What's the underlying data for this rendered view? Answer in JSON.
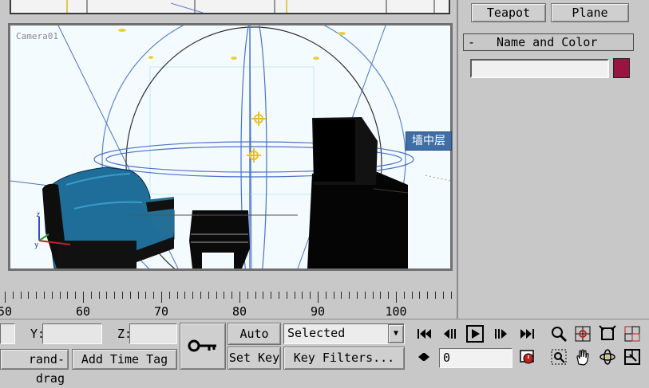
{
  "viewport": {
    "label": "Camera01",
    "object_tag": "墙中层"
  },
  "create_panel": {
    "teapot_label": "Teapot",
    "plane_label": "Plane",
    "rollout_toggle": "-",
    "rollout_title": "Name and Color",
    "name_value": "",
    "color": "#9a1442"
  },
  "timeline": {
    "ticks": [
      "50",
      "60",
      "70",
      "80",
      "90",
      "100"
    ]
  },
  "status": {
    "y_label": "Y:",
    "y_value": "",
    "z_label": "Z:",
    "z_value": "",
    "grand_drag_label": "rand-drag",
    "add_time_tag_label": "Add Time Tag",
    "auto_key_label": "Auto Key",
    "set_key_label": "Set Key",
    "selected_option": "Selected",
    "key_filters_label": "Key Filters...",
    "frame_value": "0"
  },
  "icons": {
    "key": "key-icon",
    "goto_start": "goto-start-icon",
    "prev_frame": "prev-frame-icon",
    "play": "play-icon",
    "next_frame": "next-frame-icon",
    "goto_end": "goto-end-icon",
    "key_mode": "key-mode-icon",
    "time_config": "time-config-icon",
    "zoom": "zoom-icon",
    "zoom_all": "zoom-all-icon",
    "zoom_extents": "zoom-extents-icon",
    "zoom_extents_all": "zoom-extents-all-icon",
    "zoom_region": "zoom-region-icon",
    "pan": "pan-icon",
    "orbit": "orbit-icon",
    "maximize": "maximize-viewport-icon"
  }
}
